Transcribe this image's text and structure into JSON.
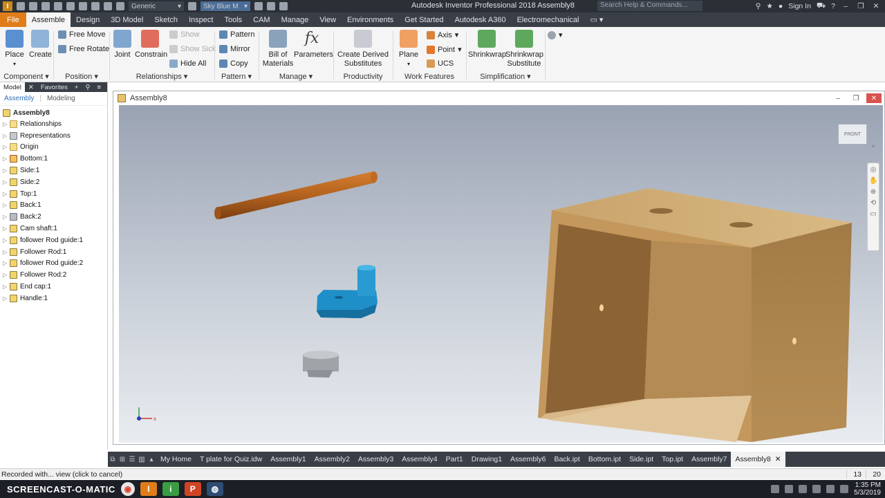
{
  "titlebar": {
    "style_value": "Generic",
    "appearance_value": "Sky Blue M",
    "title": "Autodesk Inventor Professional 2018    Assembly8",
    "search_placeholder": "Search Help & Commands...",
    "sign_in": "Sign In"
  },
  "ribbon_tabs": [
    "File",
    "Assemble",
    "Design",
    "3D Model",
    "Sketch",
    "Inspect",
    "Tools",
    "CAM",
    "Manage",
    "View",
    "Environments",
    "Get Started",
    "Autodesk A360",
    "Electromechanical"
  ],
  "ribbon": {
    "component": {
      "place": "Place",
      "create": "Create",
      "label": "Component"
    },
    "position": {
      "free_move": "Free Move",
      "free_rotate": "Free Rotate",
      "label": "Position"
    },
    "relationships": {
      "joint": "Joint",
      "constrain": "Constrain",
      "show": "Show",
      "show_sick": "Show Sick",
      "hide_all": "Hide All",
      "label": "Relationships"
    },
    "pattern": {
      "pattern": "Pattern",
      "mirror": "Mirror",
      "copy": "Copy",
      "label": "Pattern"
    },
    "manage": {
      "bom_line1": "Bill of",
      "bom_line2": "Materials",
      "parameters": "Parameters",
      "label": "Manage"
    },
    "productivity": {
      "line1": "Create Derived",
      "line2": "Substitutes",
      "label": "Productivity"
    },
    "work_features": {
      "plane": "Plane",
      "axis": "Axis",
      "point": "Point",
      "ucs": "UCS",
      "label": "Work Features"
    },
    "simplification": {
      "shrinkwrap": "Shrinkwrap",
      "sws_line1": "Shrinkwrap",
      "sws_line2": "Substitute",
      "label": "Simplification"
    }
  },
  "browser": {
    "tabs": {
      "model": "Model",
      "favorites": "Favorites"
    },
    "subtabs": {
      "assembly": "Assembly",
      "modeling": "Modeling"
    },
    "root": "Assembly8",
    "nodes": [
      {
        "label": "Relationships",
        "icon": "folder"
      },
      {
        "label": "Representations",
        "icon": "rep"
      },
      {
        "label": "Origin",
        "icon": "folder"
      },
      {
        "label": "Bottom:1",
        "icon": "ground"
      },
      {
        "label": "Side:1",
        "icon": "part"
      },
      {
        "label": "Side:2",
        "icon": "part"
      },
      {
        "label": "Top:1",
        "icon": "part"
      },
      {
        "label": "Back:1",
        "icon": "part"
      },
      {
        "label": "Back:2",
        "icon": "gray"
      },
      {
        "label": "Cam shaft:1",
        "icon": "part"
      },
      {
        "label": "follower Rod guide:1",
        "icon": "part"
      },
      {
        "label": "Follower Rod:1",
        "icon": "part"
      },
      {
        "label": "follower Rod guide:2",
        "icon": "part"
      },
      {
        "label": "Follower Rod:2",
        "icon": "part"
      },
      {
        "label": "End cap:1",
        "icon": "part"
      },
      {
        "label": "Handle:1",
        "icon": "part"
      }
    ]
  },
  "document": {
    "title": "Assembly8",
    "viewcube_face": "FRONT"
  },
  "doc_tabs": [
    "My Home",
    "T plate for Quiz.idw",
    "Assembly1",
    "Assembly2",
    "Assembly3",
    "Assembly4",
    "Part1",
    "Drawing1",
    "Assembly6",
    "Back.ipt",
    "Bottom.ipt",
    "Side.ipt",
    "Top.ipt",
    "Assembly7",
    "Assembly8"
  ],
  "status": {
    "message": "Recorded with... view (click to cancel)",
    "count1": "13",
    "count2": "20"
  },
  "taskbar": {
    "brand": "SCREENCAST-O-MATIC",
    "time": "1:35 PM",
    "date": "5/3/2019"
  }
}
